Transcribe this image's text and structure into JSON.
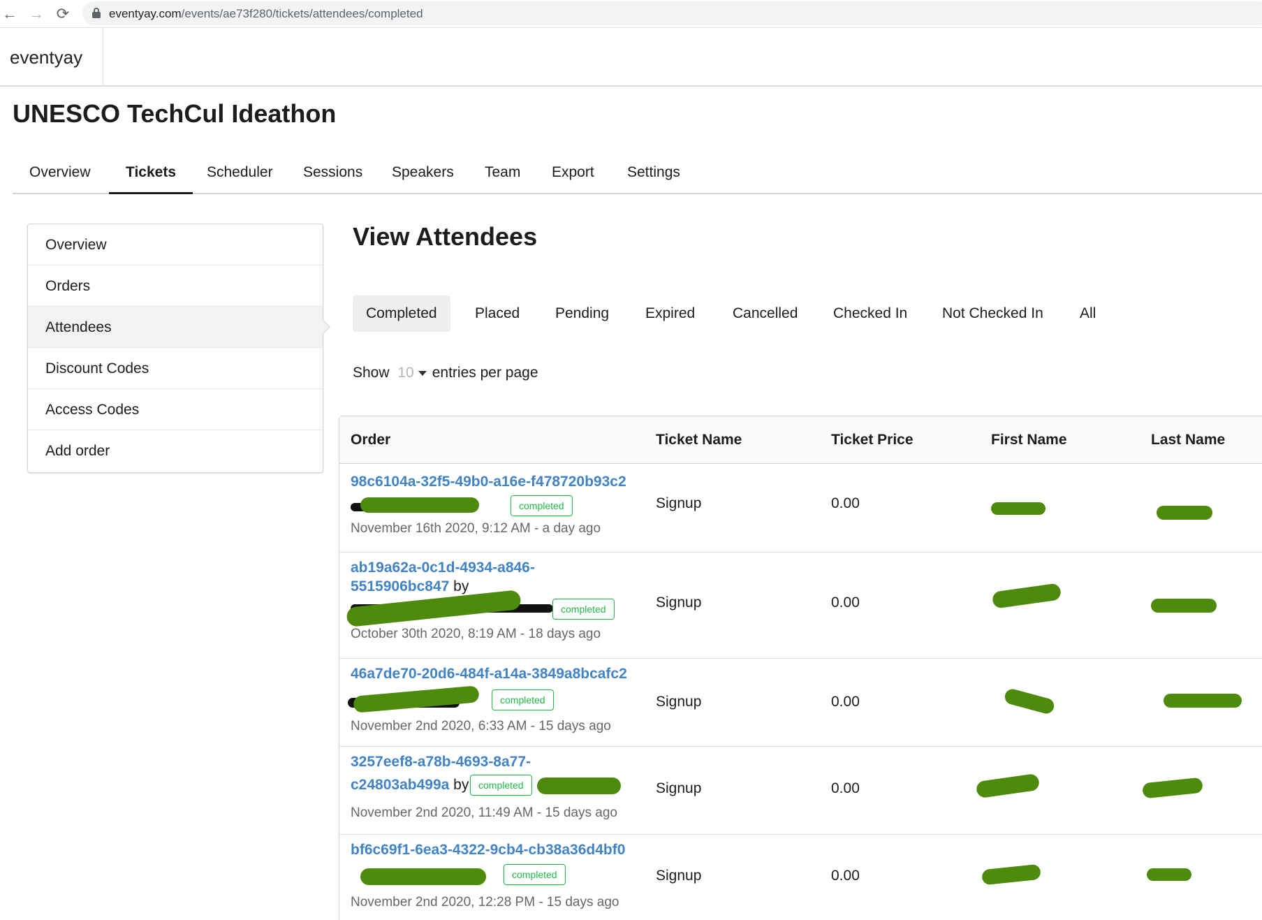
{
  "browser": {
    "url_host": "eventyay.com",
    "url_path": "/events/ae73f280/tickets/attendees/completed",
    "back_icon": "←",
    "forward_icon": "→",
    "reload_icon": "⟳"
  },
  "app": {
    "logo": "eventyay"
  },
  "event": {
    "title": "UNESCO TechCul Ideathon"
  },
  "tabs": [
    {
      "label": "Overview"
    },
    {
      "label": "Tickets"
    },
    {
      "label": "Scheduler"
    },
    {
      "label": "Sessions"
    },
    {
      "label": "Speakers"
    },
    {
      "label": "Team"
    },
    {
      "label": "Export"
    },
    {
      "label": "Settings"
    }
  ],
  "sidebar": {
    "items": [
      {
        "label": "Overview"
      },
      {
        "label": "Orders"
      },
      {
        "label": "Attendees"
      },
      {
        "label": "Discount Codes"
      },
      {
        "label": "Access Codes"
      },
      {
        "label": "Add order"
      }
    ]
  },
  "main": {
    "title": "View Attendees",
    "filters": [
      {
        "label": "Completed"
      },
      {
        "label": "Placed"
      },
      {
        "label": "Pending"
      },
      {
        "label": "Expired"
      },
      {
        "label": "Cancelled"
      },
      {
        "label": "Checked In"
      },
      {
        "label": "Not Checked In"
      },
      {
        "label": "All"
      }
    ],
    "show_label": "Show",
    "per_page": "10",
    "per_page_suffix": "entries per page"
  },
  "table": {
    "headers": [
      "Order",
      "Ticket Name",
      "Ticket Price",
      "First Name",
      "Last Name"
    ],
    "rows": [
      {
        "order_line1": "98c6104a-32f5-49b0-a16e-f478720b93c2",
        "order_line2": "",
        "by": "",
        "status": "completed",
        "date": "November 16th 2020, 9:12 AM - a day ago",
        "ticket": "Signup",
        "price": "0.00"
      },
      {
        "order_line1": "ab19a62a-0c1d-4934-a846-",
        "order_line2": "5515906bc847",
        "by": "by",
        "status": "completed",
        "date": "October 30th 2020, 8:19 AM - 18 days ago",
        "ticket": "Signup",
        "price": "0.00"
      },
      {
        "order_line1": "46a7de70-20d6-484f-a14a-3849a8bcafc2",
        "order_line2": "",
        "by": "",
        "status": "completed",
        "date": "November 2nd 2020, 6:33 AM - 15 days ago",
        "ticket": "Signup",
        "price": "0.00"
      },
      {
        "order_line1": "3257eef8-a78b-4693-8a77-",
        "order_line2": "c24803ab499a",
        "by": "by",
        "status": "completed",
        "date": "November 2nd 2020, 11:49 AM - 15 days ago",
        "ticket": "Signup",
        "price": "0.00"
      },
      {
        "order_line1": "bf6c69f1-6ea3-4322-9cb4-cb38a36d4bf0",
        "order_line2": "",
        "by": "",
        "status": "completed",
        "date": "November 2nd 2020, 12:28 PM - 15 days ago",
        "ticket": "Signup",
        "price": "0.00"
      }
    ]
  },
  "colors": {
    "link": "#4183c4",
    "badge": "#21ba45",
    "redaction": "#4e8a0c"
  }
}
